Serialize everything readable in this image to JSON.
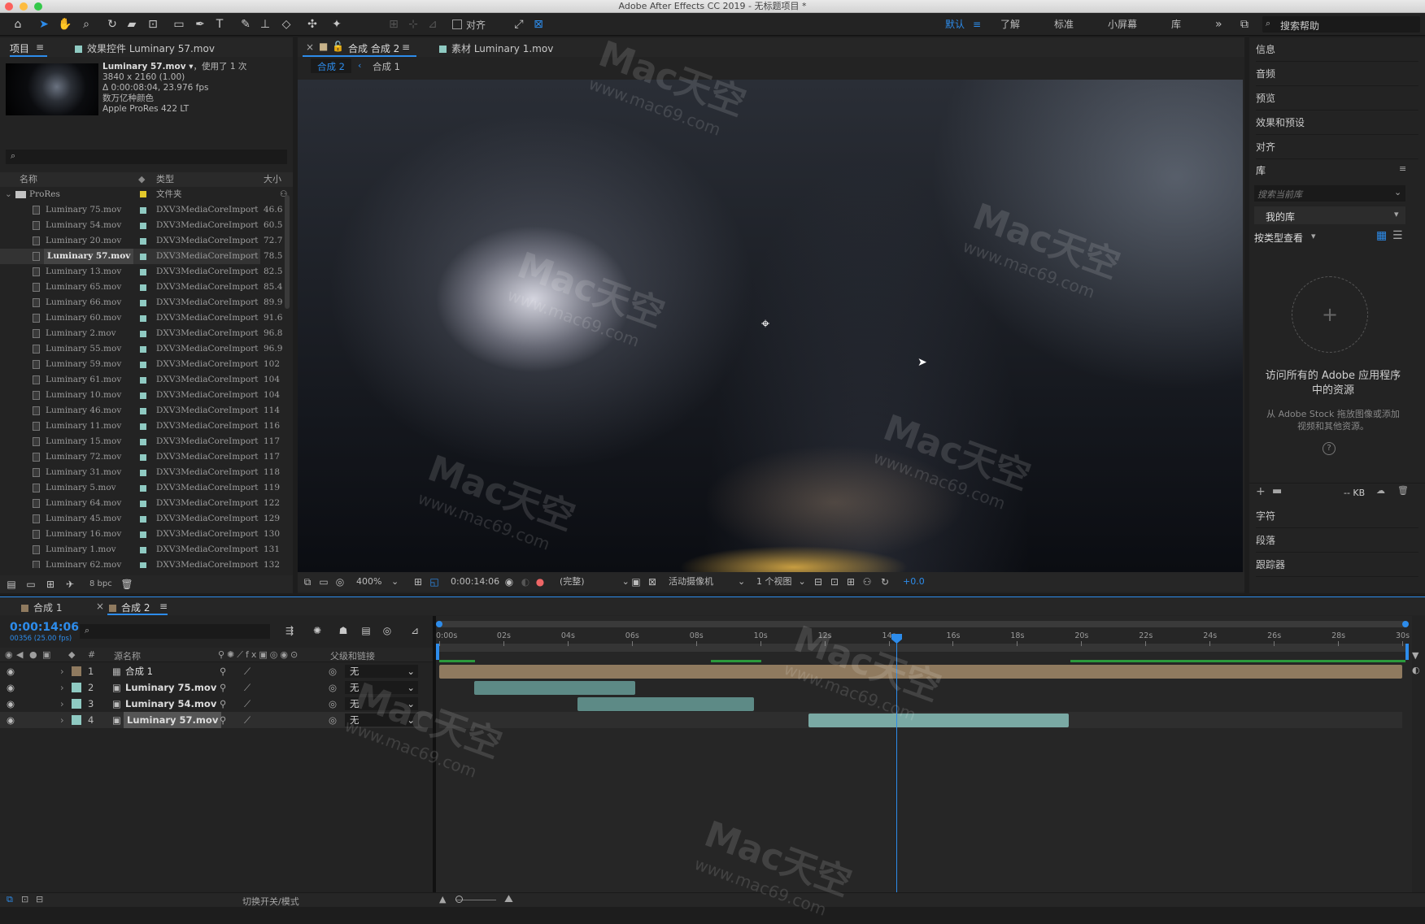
{
  "window": {
    "title": "Adobe After Effects CC 2019 - 无标题项目 *"
  },
  "workspaces": {
    "items": [
      "默认",
      "了解",
      "标准",
      "小屏幕",
      "库"
    ],
    "active": "默认",
    "search_placeholder": "搜索帮助",
    "more": "»"
  },
  "toolbar": {
    "snap_label": "对齐"
  },
  "project": {
    "tab_label": "项目",
    "effects_tab": "效果控件 Luminary 57.mov",
    "info": {
      "name": "Luminary 57.mov ▾",
      "used": "，使用了 1 次",
      "dims": "3840 x 2160 (1.00)",
      "duration": "Δ 0:00:08:04, 23.976 fps",
      "colors": "数万亿种颜色",
      "codec": "Apple ProRes 422 LT"
    },
    "columns": {
      "name": "名称",
      "type": "类型",
      "size": "大小"
    },
    "folder": {
      "name": "ProRes",
      "type": "文件夹"
    },
    "files": [
      {
        "name": "Luminary 75.mov",
        "type": "DXV3MediaCoreImport",
        "size": "46.6"
      },
      {
        "name": "Luminary 54.mov",
        "type": "DXV3MediaCoreImport",
        "size": "60.5"
      },
      {
        "name": "Luminary 20.mov",
        "type": "DXV3MediaCoreImport",
        "size": "72.7"
      },
      {
        "name": "Luminary 57.mov",
        "type": "DXV3MediaCoreImport",
        "size": "78.5"
      },
      {
        "name": "Luminary 13.mov",
        "type": "DXV3MediaCoreImport",
        "size": "82.5"
      },
      {
        "name": "Luminary 65.mov",
        "type": "DXV3MediaCoreImport",
        "size": "85.4"
      },
      {
        "name": "Luminary 66.mov",
        "type": "DXV3MediaCoreImport",
        "size": "89.9"
      },
      {
        "name": "Luminary 60.mov",
        "type": "DXV3MediaCoreImport",
        "size": "91.6"
      },
      {
        "name": "Luminary 2.mov",
        "type": "DXV3MediaCoreImport",
        "size": "96.8"
      },
      {
        "name": "Luminary 55.mov",
        "type": "DXV3MediaCoreImport",
        "size": "96.9"
      },
      {
        "name": "Luminary 59.mov",
        "type": "DXV3MediaCoreImport",
        "size": "102"
      },
      {
        "name": "Luminary 61.mov",
        "type": "DXV3MediaCoreImport",
        "size": "104"
      },
      {
        "name": "Luminary 10.mov",
        "type": "DXV3MediaCoreImport",
        "size": "104"
      },
      {
        "name": "Luminary 46.mov",
        "type": "DXV3MediaCoreImport",
        "size": "114"
      },
      {
        "name": "Luminary 11.mov",
        "type": "DXV3MediaCoreImport",
        "size": "116"
      },
      {
        "name": "Luminary 15.mov",
        "type": "DXV3MediaCoreImport",
        "size": "117"
      },
      {
        "name": "Luminary 72.mov",
        "type": "DXV3MediaCoreImport",
        "size": "117"
      },
      {
        "name": "Luminary 31.mov",
        "type": "DXV3MediaCoreImport",
        "size": "118"
      },
      {
        "name": "Luminary 5.mov",
        "type": "DXV3MediaCoreImport",
        "size": "119"
      },
      {
        "name": "Luminary 64.mov",
        "type": "DXV3MediaCoreImport",
        "size": "122"
      },
      {
        "name": "Luminary 45.mov",
        "type": "DXV3MediaCoreImport",
        "size": "129"
      },
      {
        "name": "Luminary 16.mov",
        "type": "DXV3MediaCoreImport",
        "size": "130"
      },
      {
        "name": "Luminary 1.mov",
        "type": "DXV3MediaCoreImport",
        "size": "131"
      },
      {
        "name": "Luminary 62.mov",
        "type": "DXV3MediaCoreImport",
        "size": "132"
      }
    ],
    "bpc": "8 bpc"
  },
  "viewer": {
    "comp_tab": "合成 合成 2",
    "footage_tab": "素材 Luminary 1.mov",
    "crumbs": [
      "合成 2",
      "合成 1"
    ],
    "zoom": "400%",
    "timecode": "0:00:14:06",
    "resolution": "(完整)",
    "camera": "活动摄像机",
    "views": "1 个视图",
    "exposure": "+0.0"
  },
  "right_panel": {
    "items_top": [
      "信息",
      "音频",
      "预览",
      "效果和预设",
      "对齐"
    ],
    "library": {
      "title": "库",
      "search_placeholder": "搜索当前库",
      "selected": "我的库",
      "view_by": "按类型查看",
      "headline": "访问所有的 Adobe 应用程序中的资源",
      "subtext": "从 Adobe Stock 拖放图像或添加视频和其他资源。",
      "size": "-- KB"
    },
    "items_bottom": [
      "字符",
      "段落",
      "跟踪器"
    ]
  },
  "timeline": {
    "tabs": [
      "合成 1",
      "合成 2"
    ],
    "timecode": "0:00:14:06",
    "frames": "00356 (25.00 fps)",
    "columns": {
      "num": "#",
      "source": "源名称",
      "parent": "父级和链接"
    },
    "ruler": [
      "0:00s",
      "02s",
      "04s",
      "06s",
      "08s",
      "10s",
      "12s",
      "14s",
      "16s",
      "18s",
      "20s",
      "22s",
      "24s",
      "26s",
      "28s",
      "30s"
    ],
    "layers": [
      {
        "num": "1",
        "name": "合成 1",
        "parent": "无",
        "color": "#8f7a5f"
      },
      {
        "num": "2",
        "name": "Luminary 75.mov",
        "parent": "无",
        "color": "#8fcac2"
      },
      {
        "num": "3",
        "name": "Luminary 54.mov",
        "parent": "无",
        "color": "#8fcac2"
      },
      {
        "num": "4",
        "name": "Luminary 57.mov",
        "parent": "无",
        "color": "#8fcac2"
      }
    ],
    "playhead_seconds": 14.24,
    "footer": "切换开关/模式"
  },
  "watermark": {
    "brand": "Mac天空",
    "url": "www.mac69.com"
  },
  "colors": {
    "accent": "#2d8ceb",
    "panel": "#232323",
    "bg": "#1d1d1d"
  }
}
